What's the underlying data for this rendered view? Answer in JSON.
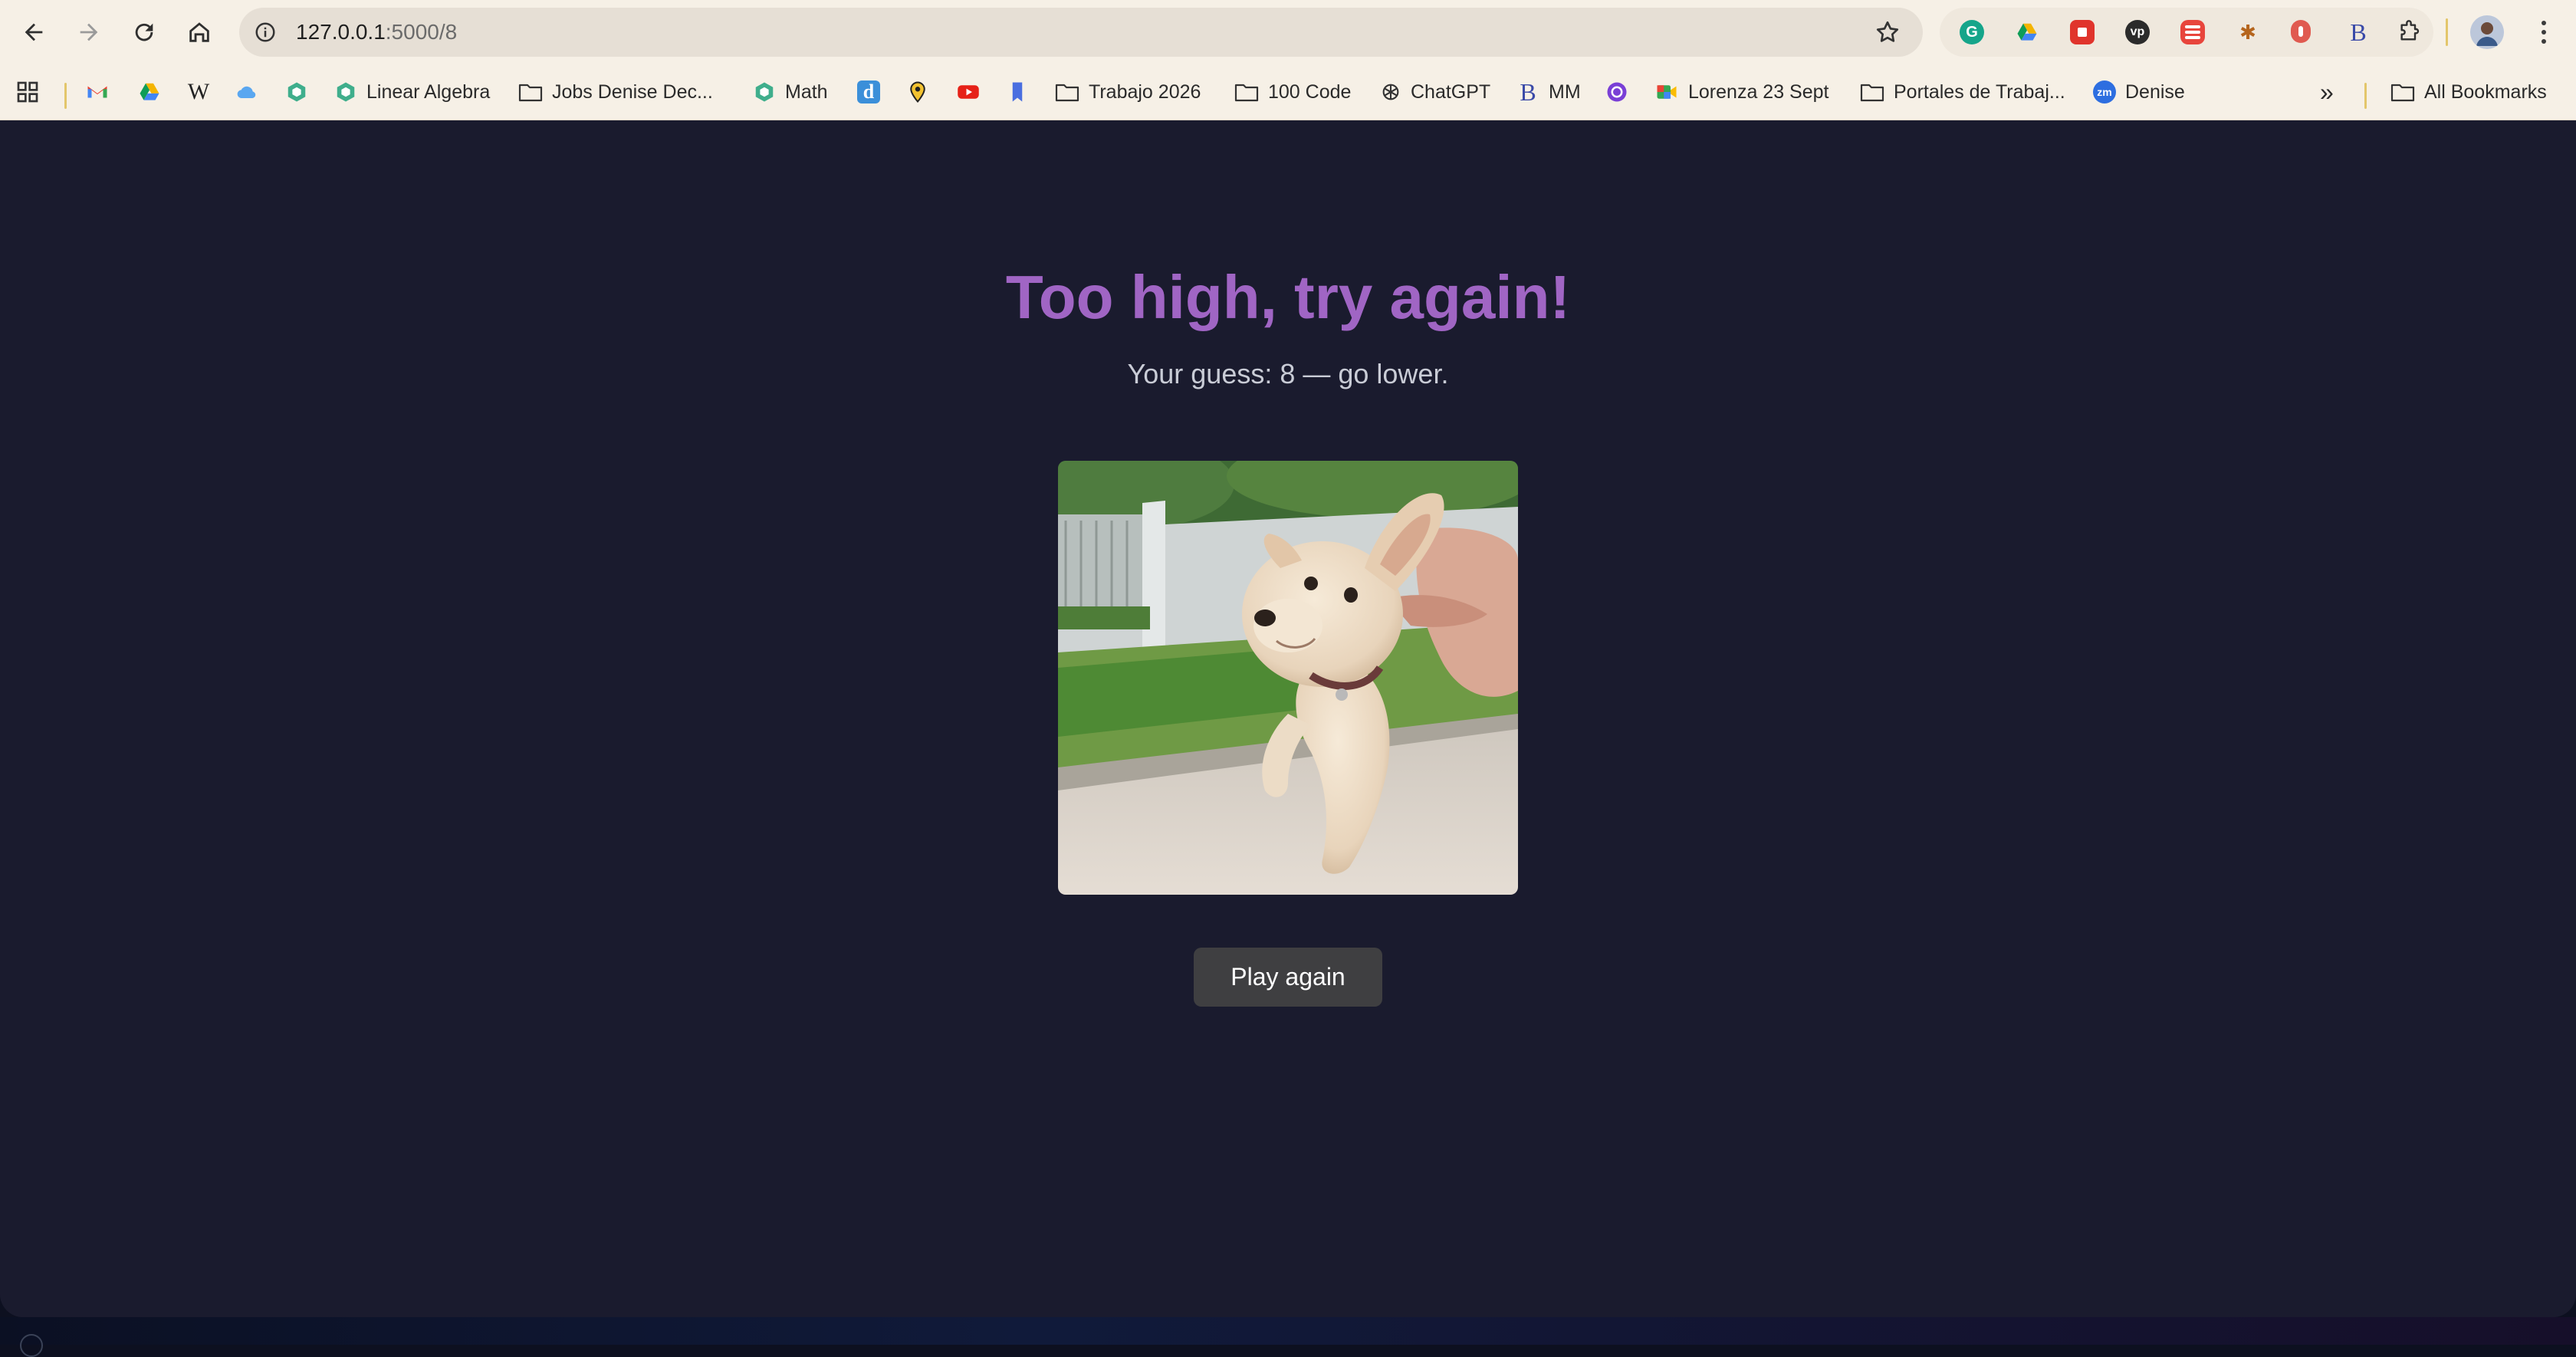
{
  "browser": {
    "url_host": "127.0.0.1",
    "url_path": ":5000/8",
    "bookmarks": {
      "linear_algebra": "Linear Algebra",
      "jobs": "Jobs Denise Dec...",
      "math": "Math",
      "trabajo": "Trabajo 2026",
      "code": "100 Code",
      "chatgpt": "ChatGPT",
      "mm": "MM",
      "lorenza": "Lorenza 23 Sept",
      "portales": "Portales de Trabaj...",
      "denise": "Denise",
      "all": "All Bookmarks"
    },
    "glyphs": {
      "wikipedia": "W",
      "d_site": "d",
      "b_site": "B",
      "mm_b": "B",
      "zm": "zm",
      "overflow": "»"
    }
  },
  "page": {
    "heading": "Too high, try again!",
    "subtext": "Your guess: 8 — go lower.",
    "image_alt": "puppy-gif",
    "play_again_label": "Play again",
    "heading_color": "#a065c4",
    "background_color": "#1a1b2e"
  }
}
